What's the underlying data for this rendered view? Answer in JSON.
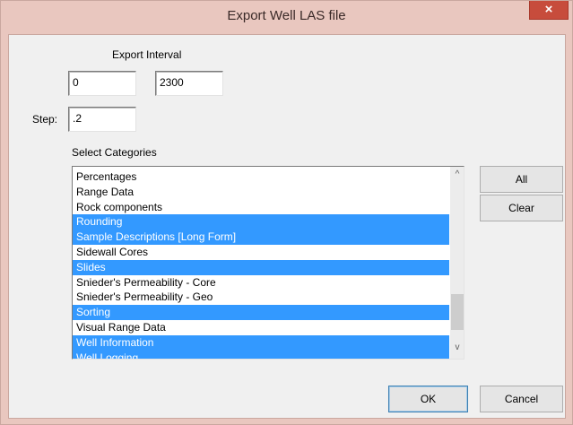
{
  "window": {
    "title": "Export Well LAS file",
    "close_glyph": "×"
  },
  "export_interval": {
    "label": "Export Interval",
    "start_value": "0",
    "end_value": "2300"
  },
  "step": {
    "label": "Step:",
    "value": ".2"
  },
  "categories": {
    "label": "Select Categories",
    "items": [
      {
        "label": "Percentages",
        "selected": false
      },
      {
        "label": "Range Data",
        "selected": false
      },
      {
        "label": "Rock components",
        "selected": false
      },
      {
        "label": "Rounding",
        "selected": true
      },
      {
        "label": "Sample Descriptions [Long Form]",
        "selected": true
      },
      {
        "label": "Sidewall Cores",
        "selected": false
      },
      {
        "label": "Slides",
        "selected": true
      },
      {
        "label": "Snieder's Permeability - Core",
        "selected": false
      },
      {
        "label": "Snieder's Permeability - Geo",
        "selected": false
      },
      {
        "label": "Sorting",
        "selected": true
      },
      {
        "label": "Visual Range Data",
        "selected": false
      },
      {
        "label": "Well Information",
        "selected": true
      },
      {
        "label": "Well Logging",
        "selected": true
      }
    ],
    "scroll_up_glyph": "^",
    "scroll_down_glyph": "v"
  },
  "buttons": {
    "all": "All",
    "clear": "Clear",
    "ok": "OK",
    "cancel": "Cancel"
  },
  "colors": {
    "selection": "#3399ff",
    "frame": "#e9c7bf",
    "close": "#c74c3c"
  }
}
